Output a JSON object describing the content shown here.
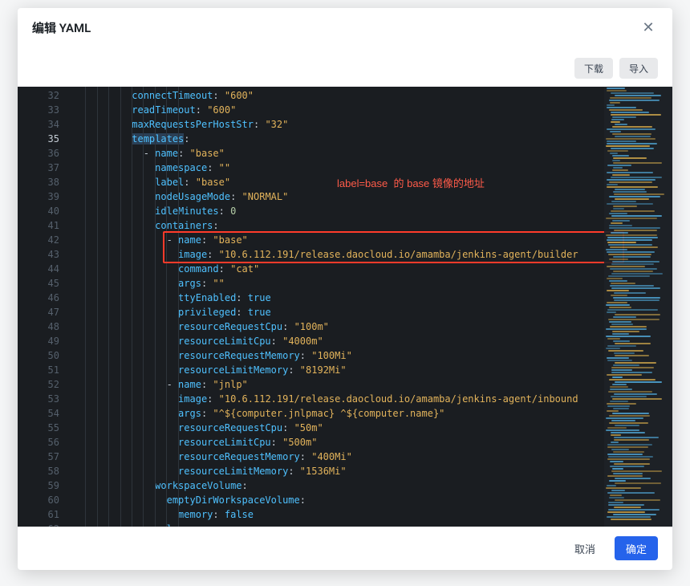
{
  "modal": {
    "title": "编辑 YAML"
  },
  "toolbar": {
    "download": "下载",
    "import": "导入"
  },
  "footer": {
    "cancel": "取消",
    "confirm": "确定"
  },
  "annotation": {
    "text": "label=base  的 base 镜像的地址"
  },
  "editor": {
    "startLine": 32,
    "currentLine": 35,
    "highlightBox": {
      "startLine": 42,
      "endLine": 43
    },
    "lines": [
      {
        "indent": 10,
        "t": [
          [
            "key",
            "connectTimeout"
          ],
          [
            "colon",
            ":"
          ],
          [
            "sp",
            " "
          ],
          [
            "str",
            "\"600\""
          ]
        ]
      },
      {
        "indent": 10,
        "t": [
          [
            "key",
            "readTimeout"
          ],
          [
            "colon",
            ":"
          ],
          [
            "sp",
            " "
          ],
          [
            "str",
            "\"600\""
          ]
        ]
      },
      {
        "indent": 10,
        "t": [
          [
            "key",
            "maxRequestsPerHostStr"
          ],
          [
            "colon",
            ":"
          ],
          [
            "sp",
            " "
          ],
          [
            "str",
            "\"32\""
          ]
        ]
      },
      {
        "indent": 10,
        "t": [
          [
            "keyhi",
            "templates"
          ],
          [
            "colon",
            ":"
          ]
        ]
      },
      {
        "indent": 12,
        "t": [
          [
            "dash",
            "- "
          ],
          [
            "key",
            "name"
          ],
          [
            "colon",
            ":"
          ],
          [
            "sp",
            " "
          ],
          [
            "str",
            "\"base\""
          ]
        ]
      },
      {
        "indent": 14,
        "t": [
          [
            "key",
            "namespace"
          ],
          [
            "colon",
            ":"
          ],
          [
            "sp",
            " "
          ],
          [
            "str",
            "\"\""
          ]
        ]
      },
      {
        "indent": 14,
        "t": [
          [
            "key",
            "label"
          ],
          [
            "colon",
            ":"
          ],
          [
            "sp",
            " "
          ],
          [
            "str",
            "\"base\""
          ]
        ]
      },
      {
        "indent": 14,
        "t": [
          [
            "key",
            "nodeUsageMode"
          ],
          [
            "colon",
            ":"
          ],
          [
            "sp",
            " "
          ],
          [
            "str",
            "\"NORMAL\""
          ]
        ]
      },
      {
        "indent": 14,
        "t": [
          [
            "key",
            "idleMinutes"
          ],
          [
            "colon",
            ":"
          ],
          [
            "sp",
            " "
          ],
          [
            "num",
            "0"
          ]
        ]
      },
      {
        "indent": 14,
        "t": [
          [
            "key",
            "containers"
          ],
          [
            "colon",
            ":"
          ]
        ]
      },
      {
        "indent": 16,
        "t": [
          [
            "dash",
            "- "
          ],
          [
            "key",
            "name"
          ],
          [
            "colon",
            ":"
          ],
          [
            "sp",
            " "
          ],
          [
            "str",
            "\"base\""
          ]
        ]
      },
      {
        "indent": 18,
        "t": [
          [
            "key",
            "image"
          ],
          [
            "colon",
            ":"
          ],
          [
            "sp",
            " "
          ],
          [
            "str",
            "\"10.6.112.191/release.daocloud.io/amamba/jenkins-agent/builder"
          ]
        ]
      },
      {
        "indent": 18,
        "t": [
          [
            "key",
            "command"
          ],
          [
            "colon",
            ":"
          ],
          [
            "sp",
            " "
          ],
          [
            "str",
            "\"cat\""
          ]
        ]
      },
      {
        "indent": 18,
        "t": [
          [
            "key",
            "args"
          ],
          [
            "colon",
            ":"
          ],
          [
            "sp",
            " "
          ],
          [
            "str",
            "\"\""
          ]
        ]
      },
      {
        "indent": 18,
        "t": [
          [
            "key",
            "ttyEnabled"
          ],
          [
            "colon",
            ":"
          ],
          [
            "sp",
            " "
          ],
          [
            "bool",
            "true"
          ]
        ]
      },
      {
        "indent": 18,
        "t": [
          [
            "key",
            "privileged"
          ],
          [
            "colon",
            ":"
          ],
          [
            "sp",
            " "
          ],
          [
            "bool",
            "true"
          ]
        ]
      },
      {
        "indent": 18,
        "t": [
          [
            "key",
            "resourceRequestCpu"
          ],
          [
            "colon",
            ":"
          ],
          [
            "sp",
            " "
          ],
          [
            "str",
            "\"100m\""
          ]
        ]
      },
      {
        "indent": 18,
        "t": [
          [
            "key",
            "resourceLimitCpu"
          ],
          [
            "colon",
            ":"
          ],
          [
            "sp",
            " "
          ],
          [
            "str",
            "\"4000m\""
          ]
        ]
      },
      {
        "indent": 18,
        "t": [
          [
            "key",
            "resourceRequestMemory"
          ],
          [
            "colon",
            ":"
          ],
          [
            "sp",
            " "
          ],
          [
            "str",
            "\"100Mi\""
          ]
        ]
      },
      {
        "indent": 18,
        "t": [
          [
            "key",
            "resourceLimitMemory"
          ],
          [
            "colon",
            ":"
          ],
          [
            "sp",
            " "
          ],
          [
            "str",
            "\"8192Mi\""
          ]
        ]
      },
      {
        "indent": 16,
        "t": [
          [
            "dash",
            "- "
          ],
          [
            "key",
            "name"
          ],
          [
            "colon",
            ":"
          ],
          [
            "sp",
            " "
          ],
          [
            "str",
            "\"jnlp\""
          ]
        ]
      },
      {
        "indent": 18,
        "t": [
          [
            "key",
            "image"
          ],
          [
            "colon",
            ":"
          ],
          [
            "sp",
            " "
          ],
          [
            "str",
            "\"10.6.112.191/release.daocloud.io/amamba/jenkins-agent/inbound"
          ]
        ]
      },
      {
        "indent": 18,
        "t": [
          [
            "key",
            "args"
          ],
          [
            "colon",
            ":"
          ],
          [
            "sp",
            " "
          ],
          [
            "str",
            "\"^${computer.jnlpmac} ^${computer.name}\""
          ]
        ]
      },
      {
        "indent": 18,
        "t": [
          [
            "key",
            "resourceRequestCpu"
          ],
          [
            "colon",
            ":"
          ],
          [
            "sp",
            " "
          ],
          [
            "str",
            "\"50m\""
          ]
        ]
      },
      {
        "indent": 18,
        "t": [
          [
            "key",
            "resourceLimitCpu"
          ],
          [
            "colon",
            ":"
          ],
          [
            "sp",
            " "
          ],
          [
            "str",
            "\"500m\""
          ]
        ]
      },
      {
        "indent": 18,
        "t": [
          [
            "key",
            "resourceRequestMemory"
          ],
          [
            "colon",
            ":"
          ],
          [
            "sp",
            " "
          ],
          [
            "str",
            "\"400Mi\""
          ]
        ]
      },
      {
        "indent": 18,
        "t": [
          [
            "key",
            "resourceLimitMemory"
          ],
          [
            "colon",
            ":"
          ],
          [
            "sp",
            " "
          ],
          [
            "str",
            "\"1536Mi\""
          ]
        ]
      },
      {
        "indent": 14,
        "t": [
          [
            "key",
            "workspaceVolume"
          ],
          [
            "colon",
            ":"
          ]
        ]
      },
      {
        "indent": 16,
        "t": [
          [
            "key",
            "emptyDirWorkspaceVolume"
          ],
          [
            "colon",
            ":"
          ]
        ]
      },
      {
        "indent": 18,
        "t": [
          [
            "key",
            "memory"
          ],
          [
            "colon",
            ":"
          ],
          [
            "sp",
            " "
          ],
          [
            "bool",
            "false"
          ]
        ]
      },
      {
        "indent": 14,
        "t": [
          [
            "key",
            "volumes"
          ],
          [
            "colon",
            ":"
          ]
        ]
      }
    ]
  }
}
